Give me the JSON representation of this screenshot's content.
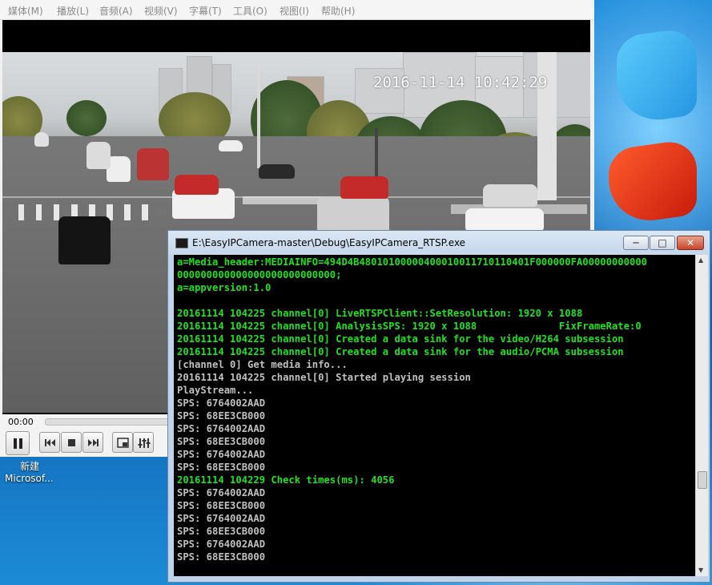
{
  "player": {
    "menu": [
      "媒体(M)",
      "播放(L)",
      "音频(A)",
      "视频(V)",
      "字幕(T)",
      "工具(O)",
      "视图(I)",
      "帮助(H)"
    ],
    "timestamp": "2016-11-14 10:42:29",
    "time": "00:00"
  },
  "desktop": {
    "icon_label_line1": "新建",
    "icon_label_line2": "Microsof..."
  },
  "console": {
    "title": "E:\\EasyIPCamera-master\\Debug\\EasyIPCamera_RTSP.exe",
    "minimize": "─",
    "maximize": "□",
    "close": "✕",
    "lines": [
      {
        "text": "a=Media_header:MEDIAINFO=494D4B48010100000400010011710110401F000000FA00000000000",
        "color": "#20e020"
      },
      {
        "text": "000000000000000000000000000;",
        "color": "#20e020"
      },
      {
        "text": "a=appversion:1.0",
        "color": "#20e020"
      },
      {
        "text": "",
        "color": "#20e020"
      },
      {
        "text": "20161114 104225 channel[0] LiveRTSPClient::SetResolution: 1920 x 1088",
        "color": "#20e020"
      },
      {
        "text": "20161114 104225 channel[0] AnalysisSPS: 1920 x 1088              FixFrameRate:0",
        "color": "#20e020"
      },
      {
        "text": "20161114 104225 channel[0] Created a data sink for the video/H264 subsession",
        "color": "#20e020"
      },
      {
        "text": "20161114 104225 channel[0] Created a data sink for the audio/PCMA subsession",
        "color": "#20e020"
      },
      {
        "text": "[channel 0] Get media info...",
        "color": "#c0c0c0"
      },
      {
        "text": "20161114 104225 channel[0] Started playing session",
        "color": "#c0c0c0"
      },
      {
        "text": "PlayStream...",
        "color": "#c0c0c0"
      },
      {
        "text": "SPS: 6764002AAD",
        "color": "#c0c0c0"
      },
      {
        "text": "SPS: 68EE3CB000",
        "color": "#c0c0c0"
      },
      {
        "text": "SPS: 6764002AAD",
        "color": "#c0c0c0"
      },
      {
        "text": "SPS: 68EE3CB000",
        "color": "#c0c0c0"
      },
      {
        "text": "SPS: 6764002AAD",
        "color": "#c0c0c0"
      },
      {
        "text": "SPS: 68EE3CB000",
        "color": "#c0c0c0"
      },
      {
        "text": "20161114 104229 Check times(ms): 4056",
        "color": "#20e020"
      },
      {
        "text": "SPS: 6764002AAD",
        "color": "#c0c0c0"
      },
      {
        "text": "SPS: 68EE3CB000",
        "color": "#c0c0c0"
      },
      {
        "text": "SPS: 6764002AAD",
        "color": "#c0c0c0"
      },
      {
        "text": "SPS: 68EE3CB000",
        "color": "#c0c0c0"
      },
      {
        "text": "SPS: 6764002AAD",
        "color": "#c0c0c0"
      },
      {
        "text": "SPS: 68EE3CB000",
        "color": "#c0c0c0"
      }
    ]
  },
  "colors": {
    "console_green": "#20e020",
    "console_gray": "#c0c0c0",
    "console_bg": "#000000",
    "titlebar": "#c5d7ec",
    "close_button": "#c8452c"
  }
}
